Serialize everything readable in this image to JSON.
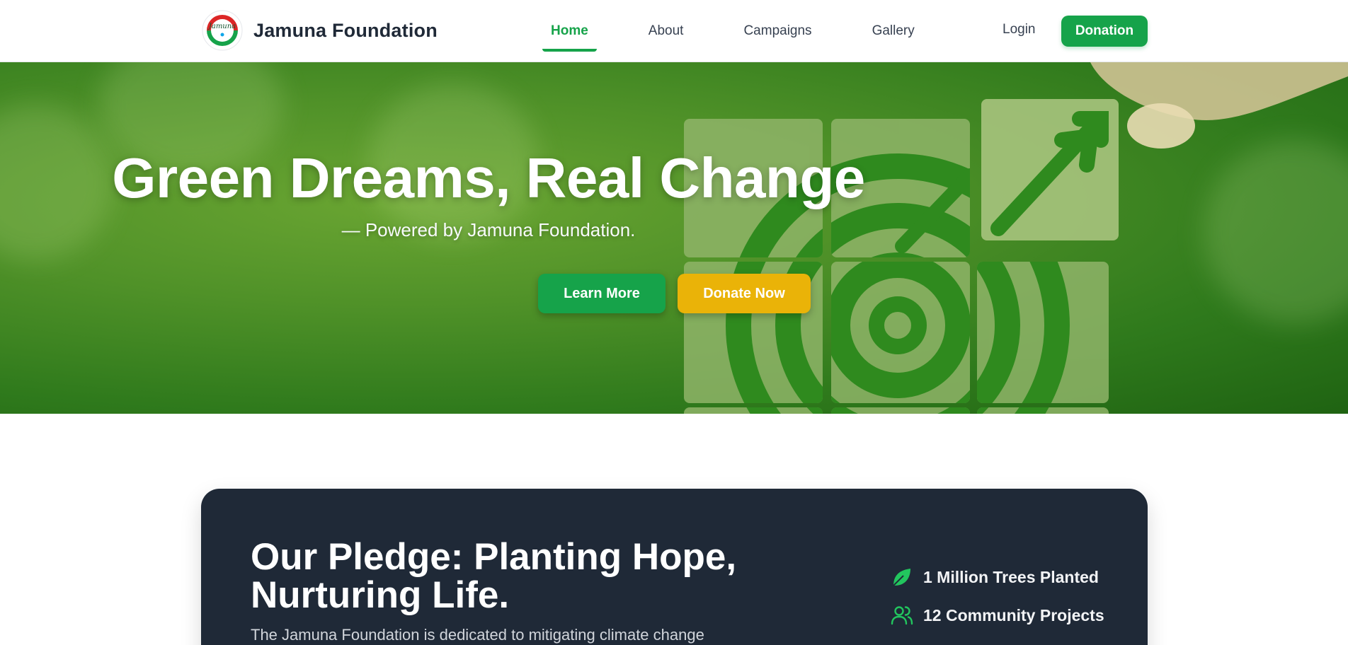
{
  "header": {
    "brand_name": "Jamuna Foundation",
    "logo_text": "Jamuna",
    "nav": [
      {
        "label": "Home",
        "active": true
      },
      {
        "label": "About",
        "active": false
      },
      {
        "label": "Campaigns",
        "active": false
      },
      {
        "label": "Gallery",
        "active": false
      }
    ],
    "login_label": "Login",
    "donation_label": "Donation"
  },
  "hero": {
    "title": "Green Dreams, Real Change",
    "subtitle": "— Powered by Jamuna Foundation.",
    "learn_more_label": "Learn More",
    "donate_now_label": "Donate Now"
  },
  "pledge": {
    "title": "Our Pledge: Planting Hope, Nurturing Life.",
    "text": "The Jamuna Foundation is dedicated to mitigating climate change",
    "stats": [
      {
        "icon": "leaf-icon",
        "label": "1 Million Trees Planted"
      },
      {
        "icon": "users-icon",
        "label": "12 Community Projects"
      }
    ]
  },
  "colors": {
    "primary": "#16a34a",
    "accent": "#eab308",
    "card_bg": "#1f2937"
  }
}
